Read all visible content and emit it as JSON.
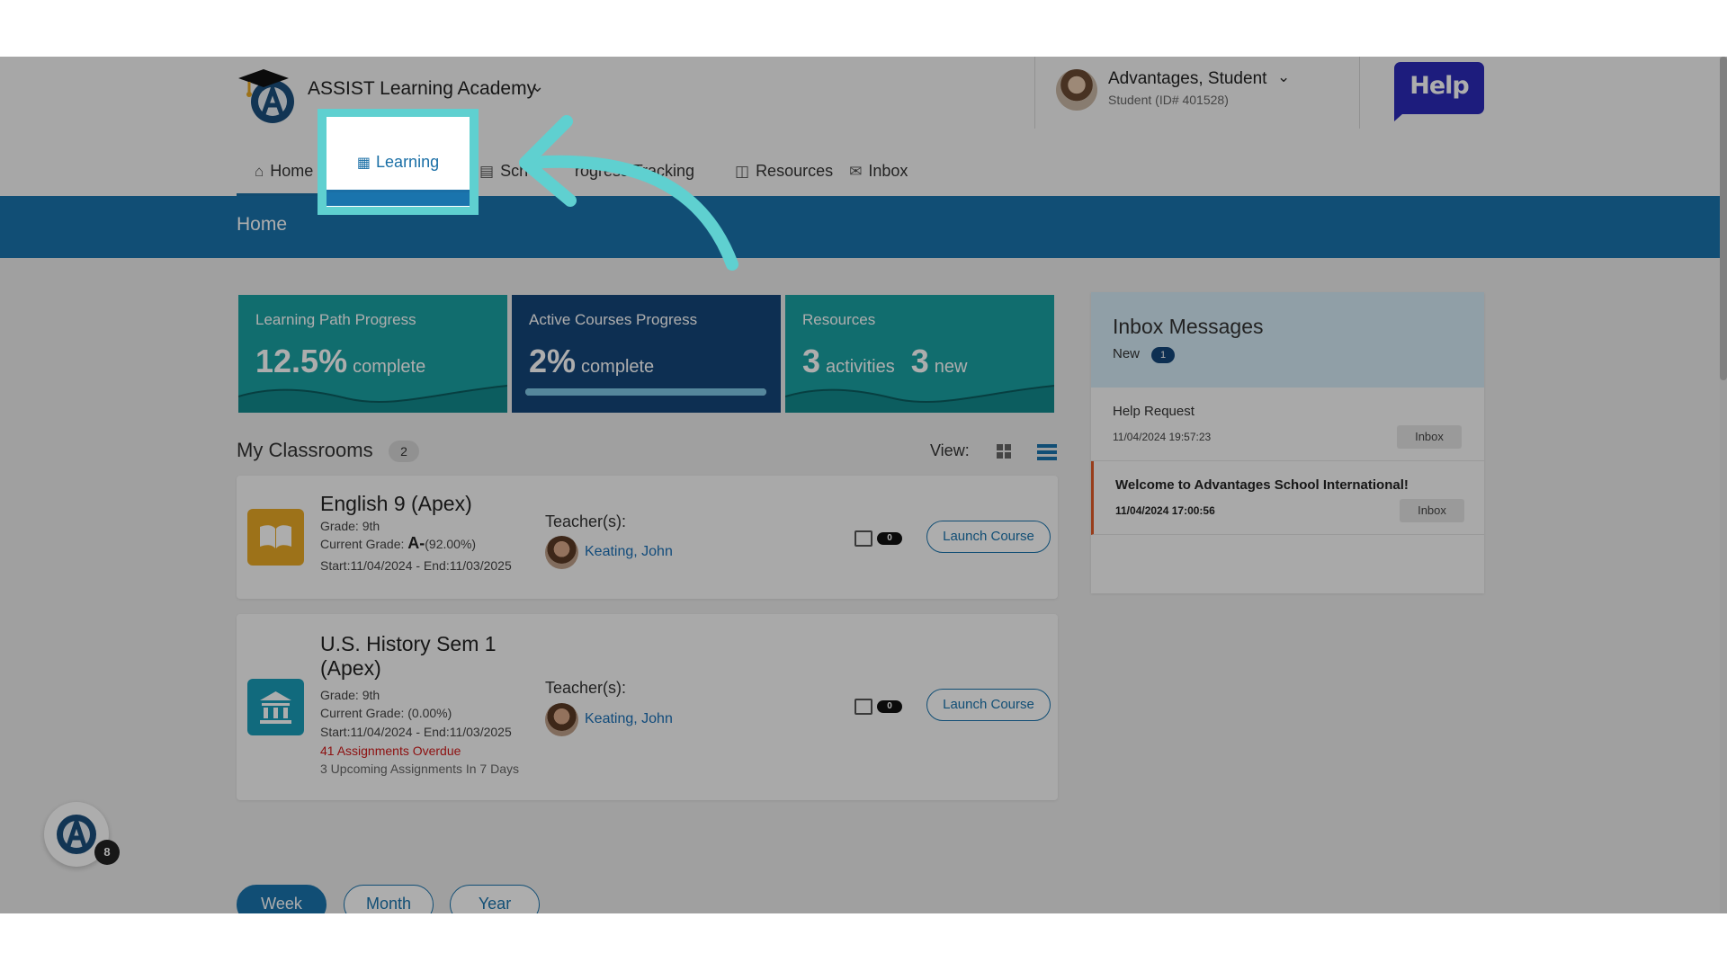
{
  "header": {
    "school_name": "ASSIST Learning Academy",
    "user_name": "Advantages, Student",
    "user_id": "Student (ID# 401528)",
    "help_label": "Help"
  },
  "nav": {
    "items": [
      {
        "label": "Home",
        "icon": "home-icon"
      },
      {
        "label": "Learning",
        "icon": "learning-icon"
      },
      {
        "label": "Sch",
        "icon": "schedule-icon"
      },
      {
        "label": "rogress Tracking",
        "icon": "progress-icon"
      },
      {
        "label": "Resources",
        "icon": "resources-icon"
      },
      {
        "label": "Inbox",
        "icon": "inbox-icon"
      }
    ]
  },
  "band": {
    "title": "Home"
  },
  "stats": {
    "learning_path": {
      "title": "Learning Path Progress",
      "value": "12.5%",
      "unit": "complete"
    },
    "active_courses": {
      "title": "Active Courses Progress",
      "value": "2%",
      "unit": "complete",
      "progress": 0.02
    },
    "resources": {
      "title": "Resources",
      "activities_value": "3",
      "activities_label": "activities",
      "new_value": "3",
      "new_label": "new"
    }
  },
  "classrooms": {
    "title": "My Classrooms",
    "count": "2",
    "view_label": "View:",
    "items": [
      {
        "title": "English 9 (Apex)",
        "grade": "Grade: 9th",
        "current_grade_label": "Current Grade:",
        "current_grade_letter": "A-",
        "current_grade_pct": "(92.00%)",
        "dates": "Start:11/04/2024 - End:11/03/2025",
        "teacher_label": "Teacher(s):",
        "teacher_name": "Keating, John",
        "message_count": "0",
        "launch_label": "Launch Course",
        "icon": "book-icon"
      },
      {
        "title": "U.S. History Sem 1 (Apex)",
        "grade": "Grade: 9th",
        "current_grade_label": "Current Grade:",
        "current_grade_pct": "(0.00%)",
        "dates": "Start:11/04/2024 - End:11/03/2025",
        "overdue": "41 Assignments Overdue",
        "upcoming": "3 Upcoming Assignments In 7 Days",
        "teacher_label": "Teacher(s):",
        "teacher_name": "Keating, John",
        "message_count": "0",
        "launch_label": "Launch Course",
        "icon": "bank-icon"
      }
    ]
  },
  "period": {
    "week": "Week",
    "month": "Month",
    "year": "Year",
    "selected": "Week"
  },
  "inbox": {
    "title": "Inbox Messages",
    "new_label": "New",
    "new_count": "1",
    "messages": [
      {
        "subject": "Help Request",
        "date": "11/04/2024 19:57:23",
        "button": "Inbox",
        "unread": false
      },
      {
        "subject": "Welcome to Advantages School International!",
        "date": "11/04/2024 17:00:56",
        "button": "Inbox",
        "unread": true
      }
    ]
  },
  "assistant": {
    "badge_count": "8"
  },
  "colors": {
    "primary": "#1a74ad",
    "teal": "#1aa1a3",
    "navy": "#14467a",
    "highlight": "#5fd0d0",
    "overdue": "#d01a1a",
    "help": "#2b2ab8"
  }
}
